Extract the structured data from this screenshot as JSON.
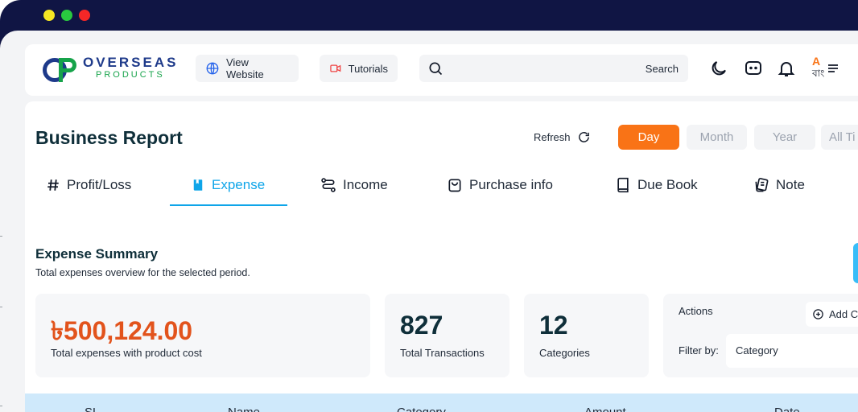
{
  "brand": {
    "name_top": "OVERSEAS",
    "name_bottom": "PRODUCTS"
  },
  "header": {
    "view_website": "View Website",
    "tutorials": "Tutorials",
    "search_label": "Search",
    "lang_top": "A",
    "lang_bottom": "বাং"
  },
  "page": {
    "title": "Business Report",
    "refresh": "Refresh",
    "periods": [
      "Day",
      "Month",
      "Year",
      "All Ti"
    ]
  },
  "tabs": [
    {
      "label": "Profit/Loss",
      "icon": "hash-icon"
    },
    {
      "label": "Expense",
      "icon": "book-bookmark-icon",
      "active": true
    },
    {
      "label": "Income",
      "icon": "route-icon"
    },
    {
      "label": "Purchase info",
      "icon": "shopping-bag-icon"
    },
    {
      "label": "Due Book",
      "icon": "book-icon"
    },
    {
      "label": "Note",
      "icon": "notes-icon"
    }
  ],
  "summary": {
    "title": "Expense Summary",
    "subtitle": "Total expenses overview for the selected period.",
    "total_value": "৳500,124.00",
    "total_label": "Total expenses with product cost",
    "transactions_value": "827",
    "transactions_label": "Total Transactions",
    "categories_value": "12",
    "categories_label": "Categories",
    "actions_label": "Actions",
    "add_button": "Add C",
    "filter_label": "Filter by:",
    "filter_value": "Category"
  },
  "table": {
    "headers": [
      "SL",
      "Name",
      "Category",
      "Amount",
      "Date"
    ]
  },
  "colors": {
    "accent_orange": "#f97316",
    "active_tab": "#0ea5e9",
    "table_header_bg": "#cfe9fb",
    "chrome": "#101544"
  }
}
